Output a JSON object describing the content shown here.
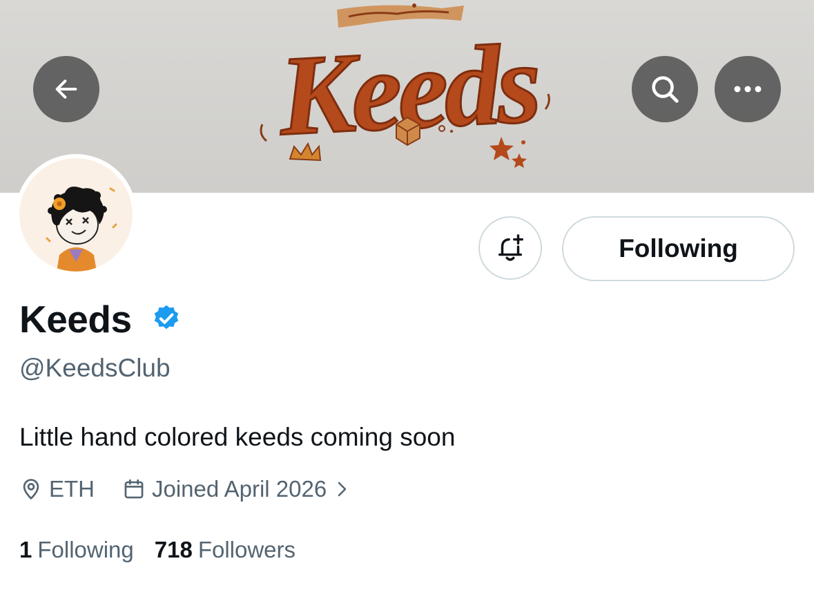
{
  "banner": {
    "logo_text": "Keeds",
    "logo_color": "#b4491b"
  },
  "nav": {
    "back_icon": "arrow-left-icon",
    "search_icon": "search-icon",
    "more_icon": "more-horizontal-icon"
  },
  "profile": {
    "display_name": "Keeds",
    "verified": true,
    "verified_color": "#1d9bf0",
    "handle": "@KeedsClub",
    "bio": "Little hand colored keeds coming soon",
    "location": "ETH",
    "joined": "Joined April 2026",
    "follow_button_label": "Following",
    "notify_icon": "bell-plus-icon"
  },
  "stats": {
    "following_count": "1",
    "following_label": "Following",
    "followers_count": "718",
    "followers_label": "Followers"
  }
}
